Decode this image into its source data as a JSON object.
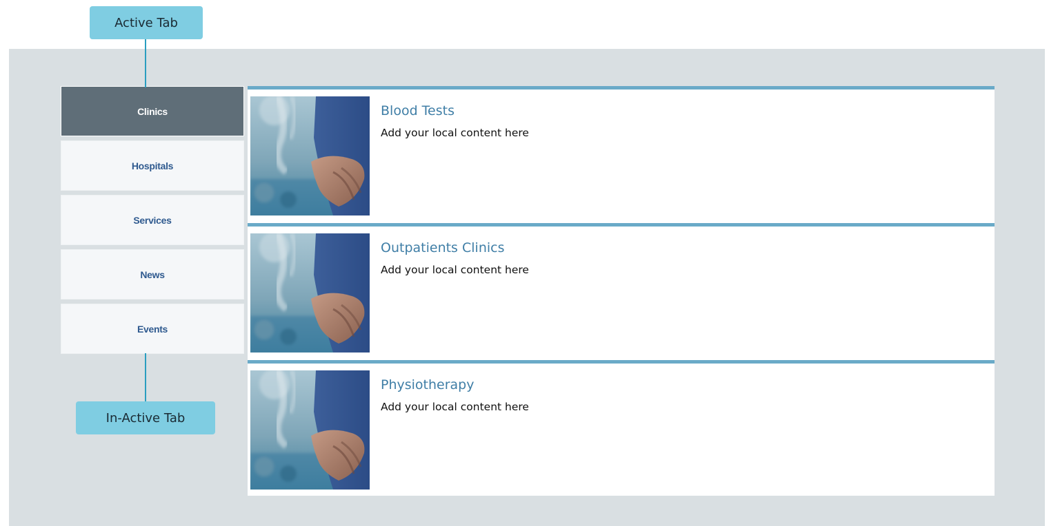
{
  "callouts": {
    "active_tab": "Active Tab",
    "inactive_tab": "In-Active Tab"
  },
  "tabs": [
    {
      "label": "Clinics",
      "active": true
    },
    {
      "label": "Hospitals",
      "active": false
    },
    {
      "label": "Services",
      "active": false
    },
    {
      "label": "News",
      "active": false
    },
    {
      "label": "Events",
      "active": false
    }
  ],
  "cards": [
    {
      "title": "Blood Tests",
      "text": "Add your local content here",
      "image": "doctor-photo"
    },
    {
      "title": "Outpatients Clinics",
      "text": "Add your local content here",
      "image": "doctor-photo"
    },
    {
      "title": "Physiotherapy",
      "text": "Add your local content here",
      "image": "doctor-photo"
    }
  ],
  "colors": {
    "callout": "#7fcde2",
    "active_tab": "#5f6e78",
    "tab_text": "#2f5a8f",
    "card_border": "#6aaac8",
    "card_title": "#3f7ea6",
    "panel": "#d9dfe2"
  }
}
